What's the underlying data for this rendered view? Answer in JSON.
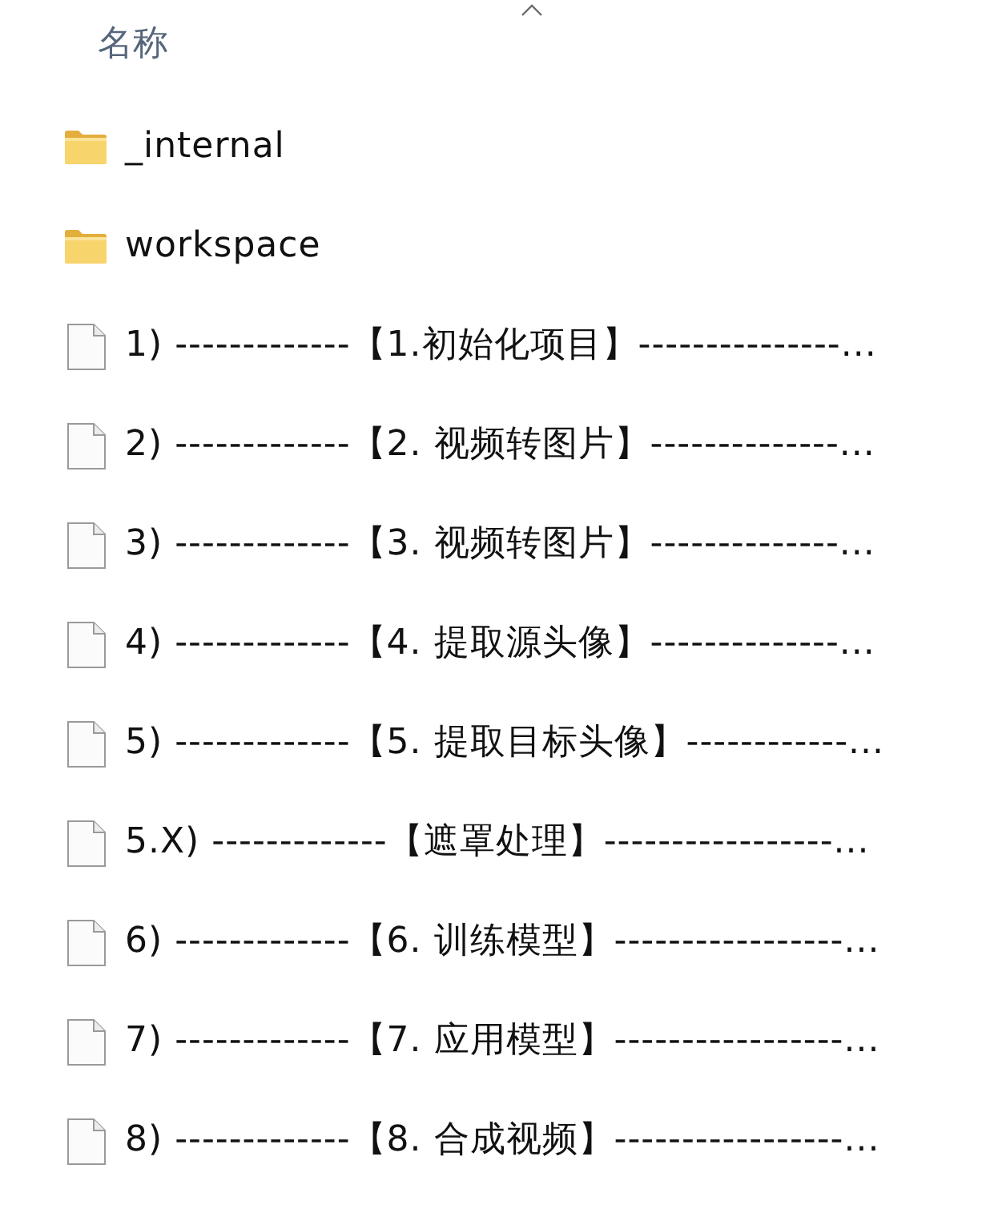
{
  "header": {
    "column": "名称",
    "sorted_ascending": true
  },
  "items": [
    {
      "kind": "folder",
      "name": "_internal"
    },
    {
      "kind": "folder",
      "name": "workspace"
    },
    {
      "kind": "file",
      "name": "1) -------------【1.初始化项目】---------------..."
    },
    {
      "kind": "file",
      "name": "2) -------------【2. 视频转图片】--------------..."
    },
    {
      "kind": "file",
      "name": "3) -------------【3. 视频转图片】--------------..."
    },
    {
      "kind": "file",
      "name": "4) -------------【4. 提取源头像】--------------..."
    },
    {
      "kind": "file",
      "name": "5) -------------【5. 提取目标头像】------------..."
    },
    {
      "kind": "file",
      "name": "5.X) -------------【遮罩处理】-----------------..."
    },
    {
      "kind": "file",
      "name": "6) -------------【6. 训练模型】-----------------..."
    },
    {
      "kind": "file",
      "name": "7) -------------【7. 应用模型】-----------------..."
    },
    {
      "kind": "file",
      "name": "8) -------------【8. 合成视频】-----------------..."
    }
  ]
}
